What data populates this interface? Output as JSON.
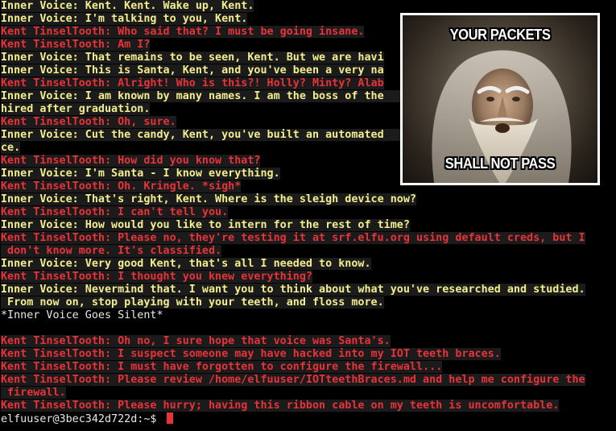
{
  "terminal": {
    "lines": [
      {
        "kind": "inner",
        "text": "Inner Voice: Kent. Kent. Wake up, Kent."
      },
      {
        "kind": "inner",
        "text": "Inner Voice: I'm talking to you, Kent."
      },
      {
        "kind": "kent",
        "text": "Kent TinselTooth: Who said that? I must be going insane."
      },
      {
        "kind": "kent",
        "text": "Kent TinselTooth: Am I?"
      },
      {
        "kind": "inner",
        "text": "Inner Voice: That remains to be seen, Kent. But we are havi"
      },
      {
        "kind": "inner",
        "text": "Inner Voice: This is Santa, Kent, and you've been a very na"
      },
      {
        "kind": "kent",
        "text": "Kent TinselTooth: Alright! Who is this?! Holly? Minty? Alab"
      },
      {
        "kind": "inner",
        "text": "Inner Voice: I am known by many names. I am the boss of the                         e"
      },
      {
        "kind": "inner",
        "text": "hired after graduation."
      },
      {
        "kind": "kent",
        "text": "Kent TinselTooth: Oh, sure."
      },
      {
        "kind": "inner",
        "text": "Inner Voice: Cut the candy, Kent, you've built an automated                        vi"
      },
      {
        "kind": "inner",
        "text": "ce."
      },
      {
        "kind": "kent",
        "text": "Kent TinselTooth: How did you know that?"
      },
      {
        "kind": "inner",
        "text": "Inner Voice: I'm Santa - I know everything."
      },
      {
        "kind": "kent",
        "text": "Kent TinselTooth: Oh. Kringle. *sigh*"
      },
      {
        "kind": "inner",
        "text": "Inner Voice: That's right, Kent. Where is the sleigh device now?"
      },
      {
        "kind": "kent",
        "text": "Kent TinselTooth: I can't tell you."
      },
      {
        "kind": "inner",
        "text": "Inner Voice: How would you like to intern for the rest of time?"
      },
      {
        "kind": "kent",
        "text": "Kent TinselTooth: Please no, they're testing it at srf.elfu.org using default creds, but I"
      },
      {
        "kind": "kent",
        "text": " don't know more. It's classified."
      },
      {
        "kind": "inner",
        "text": "Inner Voice: Very good Kent, that's all I needed to know."
      },
      {
        "kind": "kent",
        "text": "Kent TinselTooth: I thought you knew everything?"
      },
      {
        "kind": "inner",
        "text": "Inner Voice: Nevermind that. I want you to think about what you've researched and studied."
      },
      {
        "kind": "inner",
        "text": " From now on, stop playing with your teeth, and floss more."
      },
      {
        "kind": "plain",
        "text": "*Inner Voice Goes Silent*"
      },
      {
        "kind": "blank",
        "text": ""
      },
      {
        "kind": "kent",
        "text": "Kent TinselTooth: Oh no, I sure hope that voice was Santa's."
      },
      {
        "kind": "kent",
        "text": "Kent TinselTooth: I suspect someone may have hacked into my IOT teeth braces."
      },
      {
        "kind": "kent",
        "text": "Kent TinselTooth: I must have forgotten to configure the firewall..."
      },
      {
        "kind": "kent",
        "text": "Kent TinselTooth: Please review /home/elfuuser/IOTteethBraces.md and help me configure the"
      },
      {
        "kind": "kent",
        "text": " firewall."
      },
      {
        "kind": "kent",
        "text": "Kent TinselTooth: Please hurry; having this ribbon cable on my teeth is uncomfortable."
      }
    ],
    "prompt": "elfuuser@3bec342d722d:~$ "
  },
  "meme": {
    "top_caption": "YOUR PACKETS",
    "bottom_caption": "SHALL NOT PASS"
  },
  "colors": {
    "background": "#000000",
    "inner_voice": "#f2ee8e",
    "kent": "#e8323a",
    "plain": "#e8e8e8",
    "cursor": "#e8323a"
  }
}
